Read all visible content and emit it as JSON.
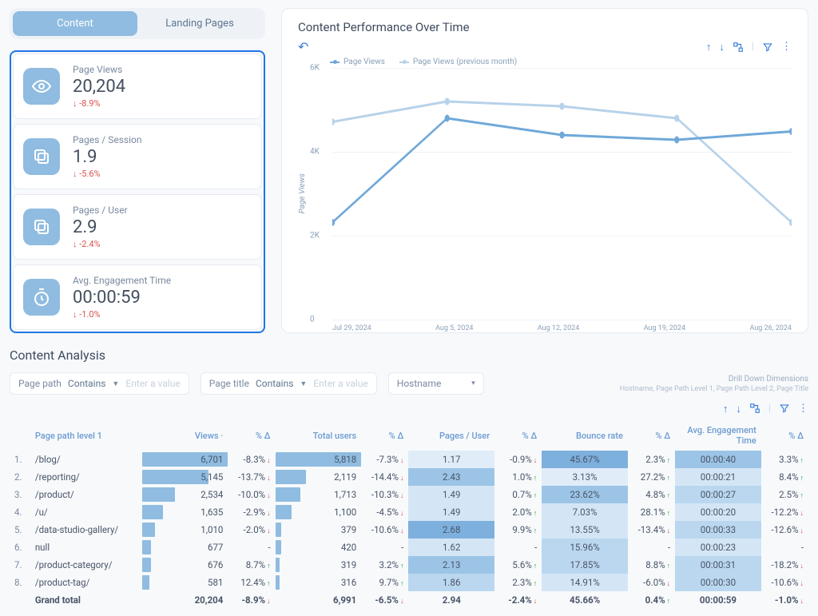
{
  "tabs": {
    "content": "Content",
    "landing": "Landing Pages"
  },
  "metrics": [
    {
      "label": "Page Views",
      "value": "20,204",
      "delta": "-8.9%",
      "dir": "down",
      "icon": "eye"
    },
    {
      "label": "Pages / Session",
      "value": "1.9",
      "delta": "-5.6%",
      "dir": "down",
      "icon": "copy"
    },
    {
      "label": "Pages / User",
      "value": "2.9",
      "delta": "-2.4%",
      "dir": "down",
      "icon": "copy"
    },
    {
      "label": "Avg. Engagement Time",
      "value": "00:00:59",
      "delta": "-1.0%",
      "dir": "down",
      "icon": "timer"
    }
  ],
  "chart": {
    "title": "Content Performance Over Time",
    "ylabel": "Page Views",
    "legend": [
      "Page Views",
      "Page Views (previous month)"
    ],
    "yticks": [
      "0",
      "2K",
      "4K",
      "6K"
    ],
    "xticks": [
      "Jul 29, 2024",
      "Aug 5, 2024",
      "Aug 12, 2024",
      "Aug 19, 2024",
      "Aug 26, 2024"
    ]
  },
  "chart_data": {
    "type": "line",
    "xlabel": "",
    "ylabel": "Page Views",
    "title": "Content Performance Over Time",
    "categories": [
      "Jul 29, 2024",
      "Aug 5, 2024",
      "Aug 12, 2024",
      "Aug 19, 2024",
      "Aug 26, 2024"
    ],
    "series": [
      {
        "name": "Page Views",
        "values": [
          2300,
          4800,
          4400,
          4300,
          4500
        ]
      },
      {
        "name": "Page Views (previous month)",
        "values": [
          4700,
          5200,
          5100,
          4800,
          2300
        ]
      }
    ],
    "ylim": [
      0,
      6000
    ]
  },
  "analysis": {
    "title": "Content Analysis",
    "filters": {
      "path_label": "Page path",
      "path_op": "Contains",
      "path_ph": "Enter a value",
      "title_label": "Page title",
      "title_op": "Contains",
      "title_ph": "Enter a value",
      "hostname_label": "Hostname"
    },
    "drilldown": {
      "title": "Drill Down Dimensions",
      "text": "Hostname, Page Path Level 1, Page Path Level 2, Page Title"
    },
    "headers": {
      "path": "Page path level 1",
      "views": "Views",
      "viewsDelta": "% Δ",
      "users": "Total users",
      "usersDelta": "% Δ",
      "ppu": "Pages / User",
      "ppuDelta": "% Δ",
      "bounce": "Bounce rate",
      "bounceDelta": "% Δ",
      "eng": "Avg. Engagement Time",
      "engDelta": "% Δ"
    },
    "rows": [
      {
        "idx": "1.",
        "path": "/blog/",
        "views": "6,701",
        "vBar": 100,
        "vD": "-8.3%",
        "vDir": "down",
        "users": "5,818",
        "uBar": 100,
        "uD": "-7.3%",
        "uDir": "down",
        "ppu": "1.17",
        "ppuH": 0,
        "pD": "-0.9%",
        "pDir": "down",
        "bounce": "45.67%",
        "bH": 4,
        "bD": "2.3%",
        "bDir": "up",
        "eng": "00:00:40",
        "eH": 3,
        "eD": "3.3%",
        "eDir": "up"
      },
      {
        "idx": "2.",
        "path": "/reporting/",
        "views": "5,145",
        "vBar": 77,
        "vD": "-13.7%",
        "vDir": "down",
        "users": "2,119",
        "uBar": 36,
        "uD": "-14.4%",
        "uDir": "down",
        "ppu": "2.43",
        "ppuH": 3,
        "pD": "1.0%",
        "pDir": "up",
        "bounce": "3.13%",
        "bH": 0,
        "bD": "27.2%",
        "bDir": "up",
        "eng": "00:00:21",
        "eH": 1,
        "eD": "8.4%",
        "eDir": "up"
      },
      {
        "idx": "3.",
        "path": "/product/",
        "views": "2,534",
        "vBar": 38,
        "vD": "-10.0%",
        "vDir": "down",
        "users": "1,713",
        "uBar": 29,
        "uD": "-10.3%",
        "uDir": "down",
        "ppu": "1.49",
        "ppuH": 1,
        "pD": "0.7%",
        "pDir": "up",
        "bounce": "23.62%",
        "bH": 3,
        "bD": "4.8%",
        "bDir": "up",
        "eng": "00:00:27",
        "eH": 2,
        "eD": "2.5%",
        "eDir": "up"
      },
      {
        "idx": "4.",
        "path": "/u/",
        "views": "1,635",
        "vBar": 24,
        "vD": "-2.9%",
        "vDir": "down",
        "users": "1,100",
        "uBar": 19,
        "uD": "-4.5%",
        "uDir": "down",
        "ppu": "1.49",
        "ppuH": 1,
        "pD": "2.0%",
        "pDir": "up",
        "bounce": "7.03%",
        "bH": 1,
        "bD": "28.1%",
        "bDir": "up",
        "eng": "00:00:20",
        "eH": 1,
        "eD": "-12.2%",
        "eDir": "down"
      },
      {
        "idx": "5.",
        "path": "/data-studio-gallery/",
        "views": "1,010",
        "vBar": 15,
        "vD": "-2.0%",
        "vDir": "down",
        "users": "379",
        "uBar": 7,
        "uD": "-10.6%",
        "uDir": "down",
        "ppu": "2.68",
        "ppuH": 4,
        "pD": "9.9%",
        "pDir": "up",
        "bounce": "13.55%",
        "bH": 1,
        "bD": "-13.4%",
        "bDir": "down",
        "eng": "00:00:33",
        "eH": 2,
        "eD": "-12.6%",
        "eDir": "down"
      },
      {
        "idx": "6.",
        "path": "null",
        "views": "677",
        "vBar": 10,
        "vD": "-",
        "vDir": "neutral",
        "users": "420",
        "uBar": 7,
        "uD": "-",
        "uDir": "neutral",
        "ppu": "1.62",
        "ppuH": 1,
        "pD": "-",
        "pDir": "neutral",
        "bounce": "15.96%",
        "bH": 2,
        "bD": "-",
        "bDir": "neutral",
        "eng": "00:00:23",
        "eH": 1,
        "eD": "-",
        "eDir": "neutral"
      },
      {
        "idx": "7.",
        "path": "/product-category/",
        "views": "676",
        "vBar": 10,
        "vD": "8.7%",
        "vDir": "up",
        "users": "319",
        "uBar": 5,
        "uD": "3.2%",
        "uDir": "up",
        "ppu": "2.13",
        "ppuH": 3,
        "pD": "5.6%",
        "pDir": "up",
        "bounce": "17.85%",
        "bH": 2,
        "bD": "8.8%",
        "bDir": "up",
        "eng": "00:00:31",
        "eH": 2,
        "eD": "-18.2%",
        "eDir": "down"
      },
      {
        "idx": "8.",
        "path": "/product-tag/",
        "views": "581",
        "vBar": 9,
        "vD": "12.4%",
        "vDir": "up",
        "users": "316",
        "uBar": 5,
        "uD": "9.7%",
        "uDir": "up",
        "ppu": "1.86",
        "ppuH": 2,
        "pD": "2.3%",
        "pDir": "up",
        "bounce": "14.91%",
        "bH": 1,
        "bD": "-6.0%",
        "bDir": "down",
        "eng": "00:00:30",
        "eH": 2,
        "eD": "-10.6%",
        "eDir": "down"
      }
    ],
    "total": {
      "label": "Grand total",
      "views": "20,204",
      "vD": "-8.9%",
      "vDir": "down",
      "users": "6,991",
      "uD": "-6.5%",
      "uDir": "down",
      "ppu": "2.94",
      "pD": "-2.4%",
      "pDir": "down",
      "bounce": "45.66%",
      "bD": "0.4%",
      "bDir": "up",
      "eng": "00:00:59",
      "eD": "-1.0%",
      "eDir": "down"
    }
  }
}
